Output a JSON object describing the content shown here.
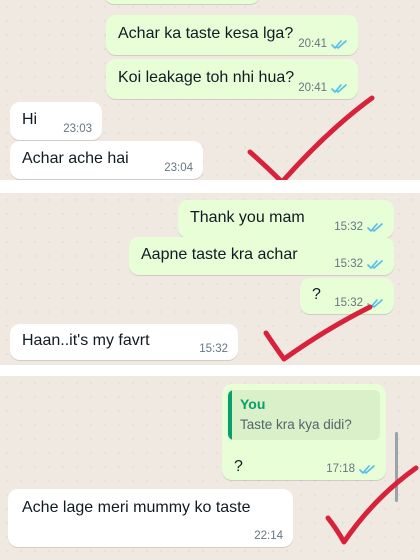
{
  "panel1": {
    "messages": [
      {
        "text": "Achar ka taste kesa lga?",
        "time": "20:41"
      },
      {
        "text": "Koi leakage toh nhi hua?",
        "time": "20:41"
      },
      {
        "text": "Hi",
        "time": "23:03"
      },
      {
        "text": "Achar ache hai",
        "time": "23:04"
      }
    ]
  },
  "panel2": {
    "messages": [
      {
        "text": "Thank you mam",
        "time": "15:32"
      },
      {
        "text": "Aapne taste kra achar",
        "time": "15:32"
      },
      {
        "text": "?",
        "time": "15:32"
      },
      {
        "text": "Haan..it's my favrt",
        "time": "15:32"
      }
    ]
  },
  "panel3": {
    "reply": {
      "quote_author": "You",
      "quote_text": "Taste kra kya didi?",
      "text": "?",
      "time": "17:18"
    },
    "incoming": {
      "text": "Ache lage meri mummy ko taste",
      "time": "22:14"
    }
  },
  "colors": {
    "outgoing_bubble": "#e7fed6",
    "incoming_bubble": "#ffffff",
    "read_ticks": "#53bdeb",
    "check_mark": "#d8213a",
    "chat_background": "#efe9e1"
  },
  "icons": [
    "read-receipt-icon",
    "check-mark-annotation"
  ]
}
